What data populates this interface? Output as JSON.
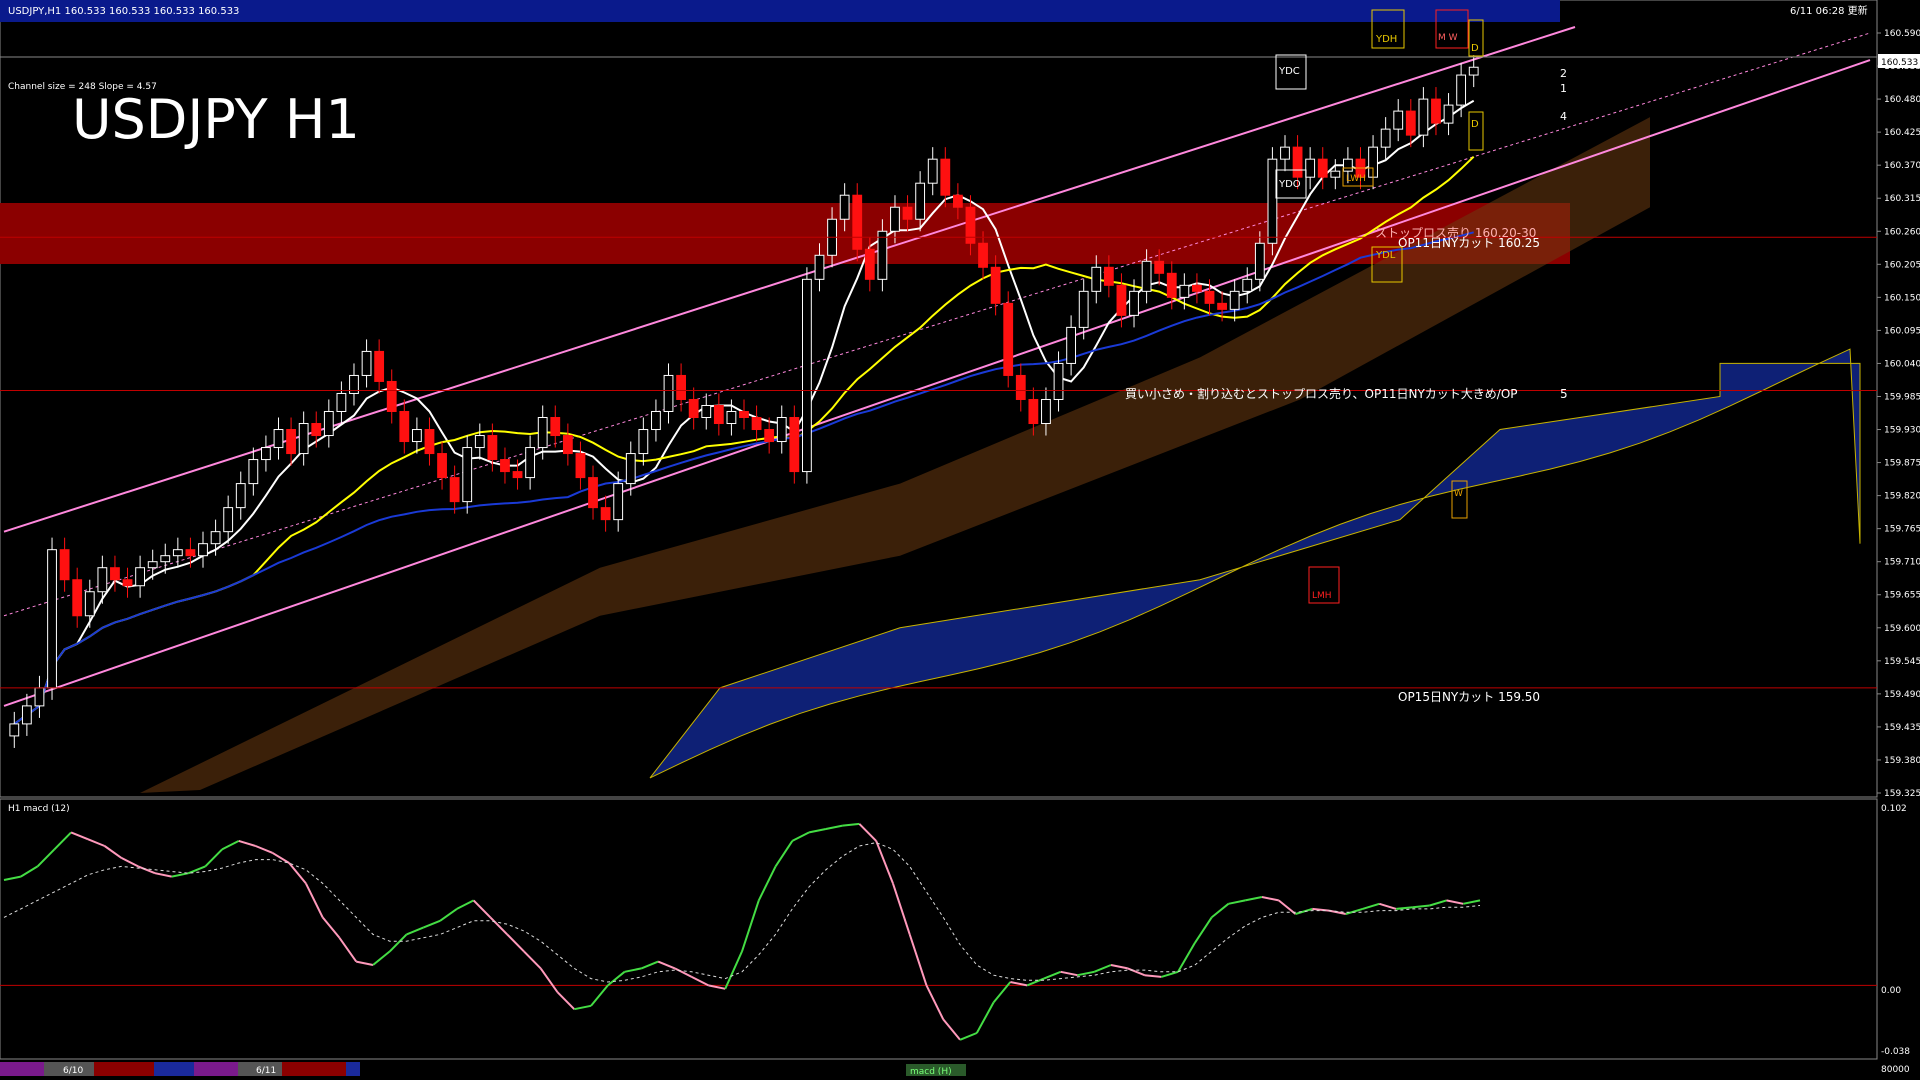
{
  "window": {
    "symbol_line": "USDJPY,H1  160.533 160.533 160.533 160.533",
    "timestamp": "6/11 06:28 更新",
    "big_title": "USDJPY H1",
    "channel_info": "Channel size = 248 Slope = 4.57"
  },
  "annotations": {
    "stoploss_label": "ストップロス売り 160.20-30",
    "op11_label": "OP11日NYカット 160.25",
    "comment": "買い小さめ・割り込むとストップロス売り、OP11日NYカット大きめ/OP",
    "op15_label": "OP15日NYカット 159.50",
    "num_5": "5",
    "num_1": "1",
    "num_2": "2",
    "num_4": "4"
  },
  "levels": {
    "ydh": "YDH",
    "ydc": "YDC",
    "ydo": "YDO",
    "ydl": "YDL",
    "lwh": "LWH",
    "lmh": "LMH",
    "d": "D",
    "w": "W",
    "m": "M",
    "mw": "M W"
  },
  "macd": {
    "title": "H1  macd (12)",
    "top": "0.102",
    "zero": "0.00",
    "bottom": "-0.038",
    "axis_max": "80000",
    "footer_label": "macd (H)"
  },
  "bottom_bar": {
    "date1": "6/10",
    "date2": "6/11"
  },
  "colors": {
    "background": "#000000",
    "header_band": "#0a1a8c",
    "resistance_band": "#8b0000",
    "bull_candle": "#ffffff",
    "bear_candle": "#ff1010",
    "channel": "#ff88dd",
    "ma_fast": "#ffffff",
    "ma_mid": "#ffff00",
    "ma_slow": "#1a3ad6",
    "cloud_span": "#1a3ad6",
    "macd_up": "#44dd44",
    "macd_down": "#ff99bb"
  },
  "chart_data": {
    "type": "candlestick",
    "title": "USDJPY H1",
    "ylim": [
      159.325,
      160.59
    ],
    "y_ticks": [
      "160.590",
      "160.535",
      "160.480",
      "160.425",
      "160.370",
      "160.315",
      "160.260",
      "160.205",
      "160.150",
      "160.095",
      "160.040",
      "159.985",
      "159.930",
      "159.875",
      "159.820",
      "159.765",
      "159.710",
      "159.655",
      "159.600",
      "159.545",
      "159.490",
      "159.435",
      "159.380",
      "159.325"
    ],
    "current_price": "160.533",
    "horizontal_lines": [
      160.25,
      159.995,
      159.5
    ],
    "zone": [
      160.2,
      160.3
    ],
    "macd_ylim": [
      -0.038,
      0.102
    ],
    "candles": {
      "open": [
        159.42,
        159.44,
        159.47,
        159.5,
        159.73,
        159.68,
        159.62,
        159.66,
        159.7,
        159.68,
        159.67,
        159.7,
        159.71,
        159.72,
        159.73,
        159.72,
        159.74,
        159.76,
        159.8,
        159.84,
        159.88,
        159.9,
        159.93,
        159.89,
        159.94,
        159.92,
        159.96,
        159.99,
        160.02,
        160.06,
        160.01,
        159.96,
        159.91,
        159.93,
        159.89,
        159.85,
        159.81,
        159.9,
        159.92,
        159.88,
        159.86,
        159.85,
        159.9,
        159.95,
        159.92,
        159.89,
        159.85,
        159.8,
        159.78,
        159.84,
        159.89,
        159.93,
        159.96,
        160.02,
        159.98,
        159.95,
        159.97,
        159.94,
        159.96,
        159.95,
        159.93,
        159.91,
        159.95,
        159.86,
        160.18,
        160.22,
        160.28,
        160.32,
        160.23,
        160.18,
        160.26,
        160.3,
        160.28,
        160.34,
        160.38,
        160.32,
        160.3,
        160.24,
        160.2,
        160.14,
        160.02,
        159.98,
        159.94,
        159.98,
        160.04,
        160.1,
        160.16,
        160.2,
        160.17,
        160.12,
        160.16,
        160.21,
        160.19,
        160.15,
        160.17,
        160.16,
        160.14,
        160.13,
        160.16,
        160.18,
        160.24,
        160.38,
        160.4,
        160.35,
        160.38,
        160.35,
        160.36,
        160.38,
        160.35,
        160.4,
        160.43,
        160.46,
        160.42,
        160.48,
        160.44,
        160.47,
        160.52
      ],
      "close": [
        159.44,
        159.47,
        159.5,
        159.73,
        159.68,
        159.62,
        159.66,
        159.7,
        159.68,
        159.67,
        159.7,
        159.71,
        159.72,
        159.73,
        159.72,
        159.74,
        159.76,
        159.8,
        159.84,
        159.88,
        159.9,
        159.93,
        159.89,
        159.94,
        159.92,
        159.96,
        159.99,
        160.02,
        160.06,
        160.01,
        159.96,
        159.91,
        159.93,
        159.89,
        159.85,
        159.81,
        159.9,
        159.92,
        159.88,
        159.86,
        159.85,
        159.9,
        159.95,
        159.92,
        159.89,
        159.85,
        159.8,
        159.78,
        159.84,
        159.89,
        159.93,
        159.96,
        160.02,
        159.98,
        159.95,
        159.97,
        159.94,
        159.96,
        159.95,
        159.93,
        159.91,
        159.95,
        159.86,
        160.18,
        160.22,
        160.28,
        160.32,
        160.23,
        160.18,
        160.26,
        160.3,
        160.28,
        160.34,
        160.38,
        160.32,
        160.3,
        160.24,
        160.2,
        160.14,
        160.02,
        159.98,
        159.94,
        159.98,
        160.04,
        160.1,
        160.16,
        160.2,
        160.17,
        160.12,
        160.16,
        160.21,
        160.19,
        160.15,
        160.17,
        160.16,
        160.14,
        160.13,
        160.16,
        160.18,
        160.24,
        160.38,
        160.4,
        160.35,
        160.38,
        160.35,
        160.36,
        160.38,
        160.35,
        160.4,
        160.43,
        160.46,
        160.42,
        160.48,
        160.44,
        160.47,
        160.52,
        160.533
      ]
    },
    "macd_line": [
      0.062,
      0.064,
      0.07,
      0.08,
      0.09,
      0.086,
      0.082,
      0.075,
      0.07,
      0.066,
      0.064,
      0.066,
      0.07,
      0.08,
      0.085,
      0.082,
      0.078,
      0.072,
      0.06,
      0.04,
      0.028,
      0.014,
      0.012,
      0.02,
      0.03,
      0.034,
      0.038,
      0.045,
      0.05,
      0.04,
      0.03,
      0.02,
      0.01,
      -0.004,
      -0.014,
      -0.012,
      0.0,
      0.008,
      0.01,
      0.014,
      0.01,
      0.005,
      0.0,
      -0.002,
      0.02,
      0.05,
      0.07,
      0.085,
      0.09,
      0.092,
      0.094,
      0.095,
      0.085,
      0.06,
      0.03,
      0.0,
      -0.02,
      -0.032,
      -0.028,
      -0.01,
      0.002,
      0.0,
      0.004,
      0.008,
      0.006,
      0.008,
      0.012,
      0.01,
      0.006,
      0.005,
      0.008,
      0.025,
      0.04,
      0.048,
      0.05,
      0.052,
      0.05,
      0.042,
      0.045,
      0.044,
      0.042,
      0.045,
      0.048,
      0.045,
      0.046,
      0.047,
      0.05,
      0.048,
      0.05
    ],
    "signal_line": [
      0.04,
      0.045,
      0.05,
      0.055,
      0.06,
      0.065,
      0.068,
      0.07,
      0.069,
      0.068,
      0.067,
      0.066,
      0.067,
      0.069,
      0.072,
      0.074,
      0.074,
      0.072,
      0.068,
      0.06,
      0.05,
      0.04,
      0.03,
      0.026,
      0.026,
      0.028,
      0.03,
      0.034,
      0.038,
      0.038,
      0.036,
      0.032,
      0.026,
      0.018,
      0.01,
      0.004,
      0.002,
      0.003,
      0.005,
      0.008,
      0.009,
      0.008,
      0.006,
      0.004,
      0.008,
      0.018,
      0.03,
      0.045,
      0.058,
      0.068,
      0.076,
      0.082,
      0.084,
      0.08,
      0.07,
      0.055,
      0.04,
      0.024,
      0.012,
      0.006,
      0.004,
      0.003,
      0.003,
      0.004,
      0.005,
      0.006,
      0.008,
      0.009,
      0.009,
      0.008,
      0.008,
      0.012,
      0.02,
      0.028,
      0.035,
      0.04,
      0.043,
      0.043,
      0.044,
      0.044,
      0.043,
      0.043,
      0.044,
      0.044,
      0.045,
      0.045,
      0.046,
      0.046,
      0.047
    ]
  }
}
